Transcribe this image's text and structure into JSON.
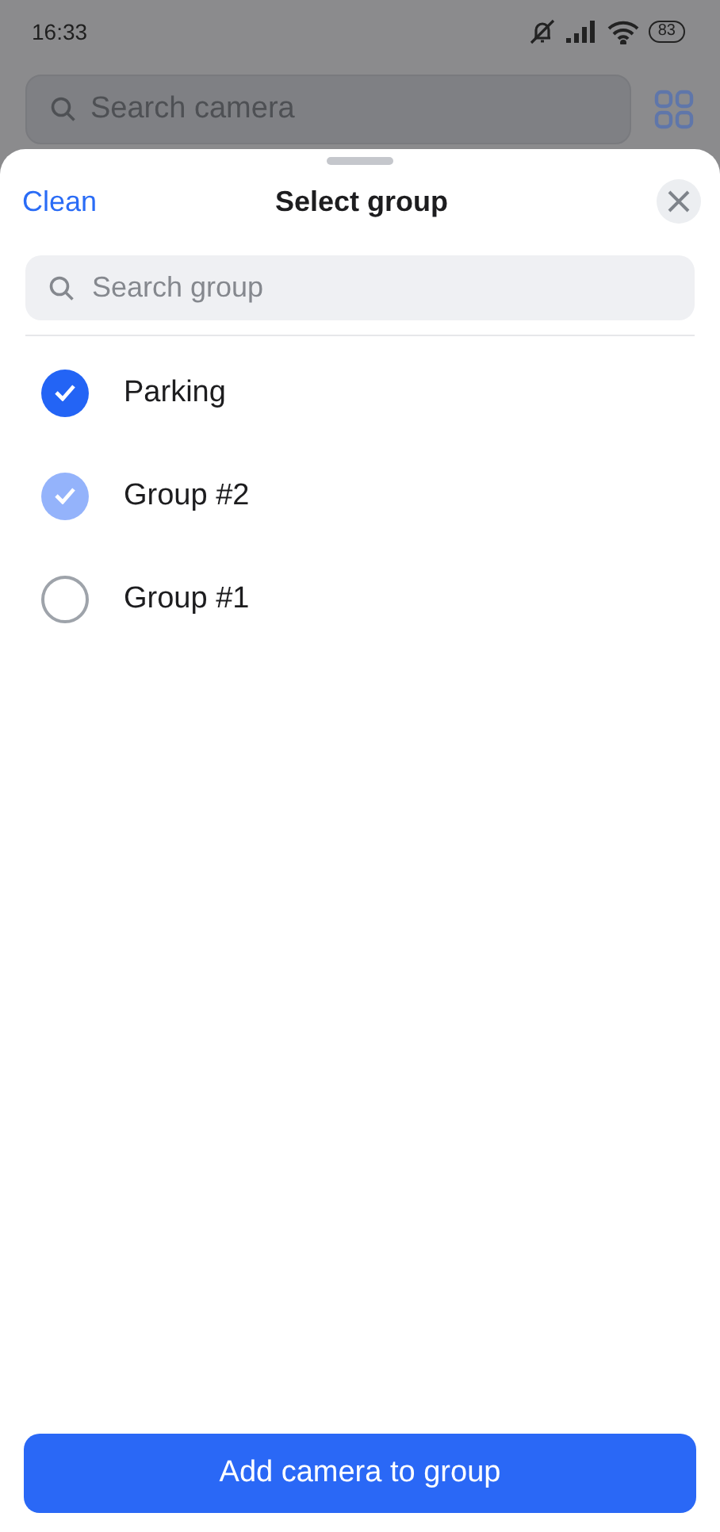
{
  "status_bar": {
    "time": "16:33",
    "battery": "83"
  },
  "background": {
    "search": {
      "placeholder": "Search camera"
    }
  },
  "sheet": {
    "clean_link": "Clean",
    "title": "Select group",
    "search": {
      "placeholder": "Search group"
    },
    "groups": [
      {
        "label": "Parking",
        "checked": true,
        "disabled": false
      },
      {
        "label": "Group #2",
        "checked": true,
        "disabled": true
      },
      {
        "label": "Group #1",
        "checked": false,
        "disabled": false
      }
    ],
    "primary_button": "Add camera to group"
  }
}
